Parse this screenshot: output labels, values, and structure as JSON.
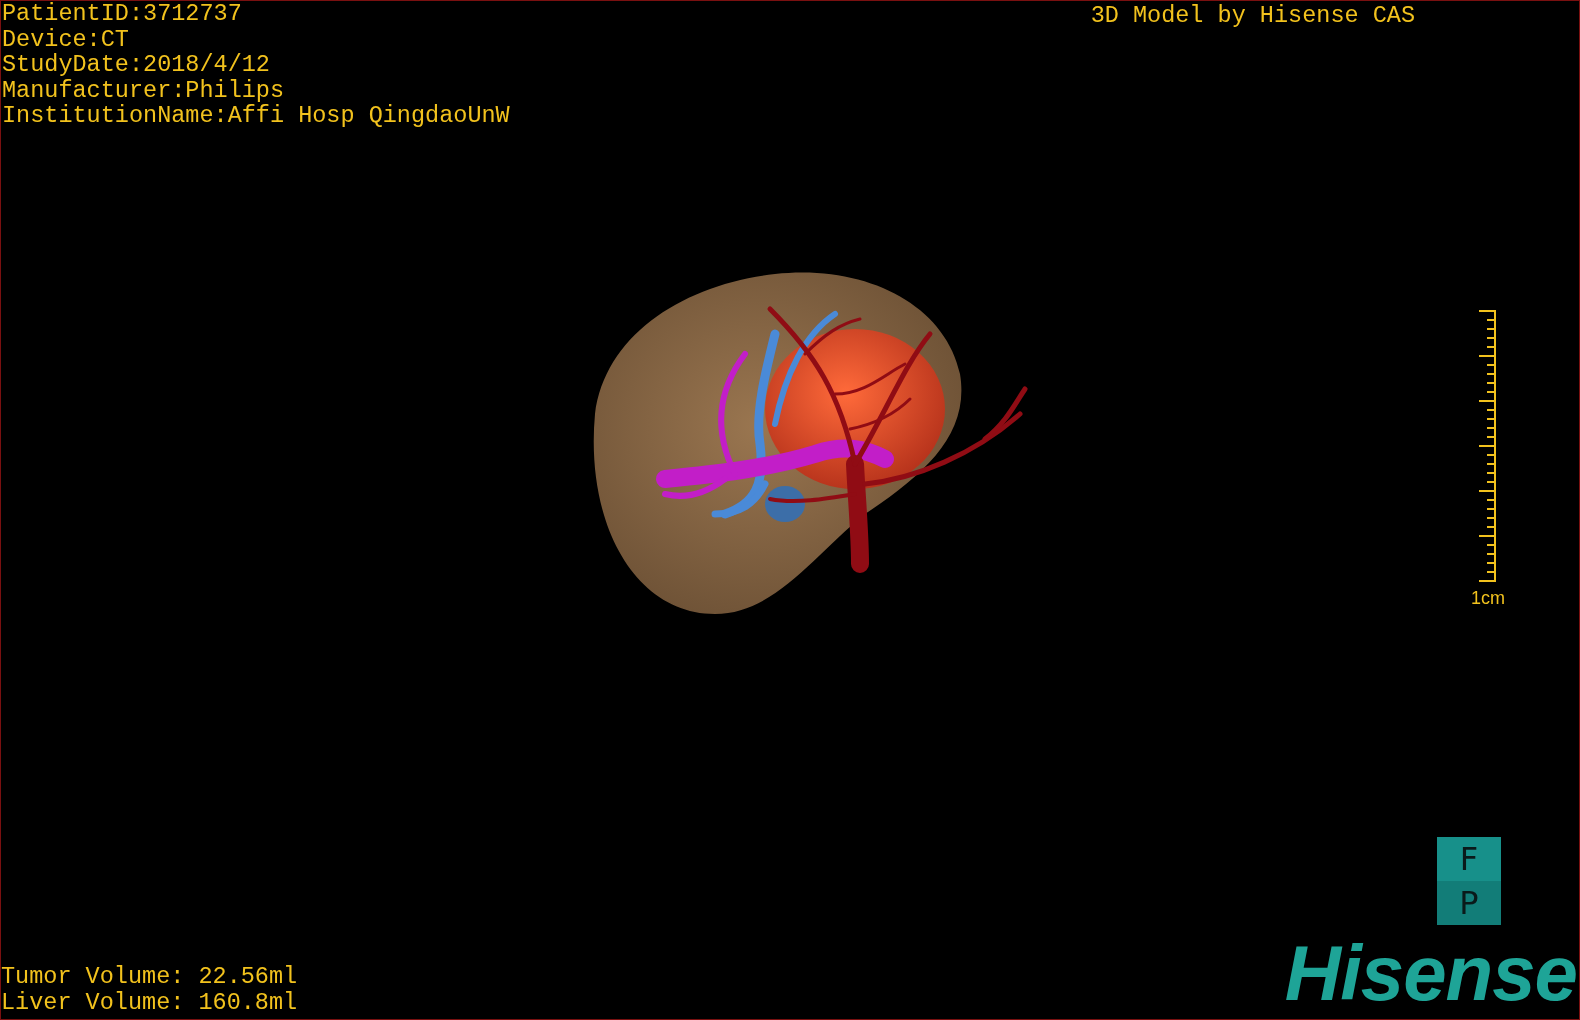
{
  "patient_info": [
    "PatientID:3712737",
    "Device:CT",
    "StudyDate:2018/4/12",
    "Manufacturer:Philips",
    "InstitutionName:Affi Hosp QingdaoUnW"
  ],
  "viewer_title": "3D Model by Hisense CAS",
  "scale_bar": {
    "label": "1cm"
  },
  "volumes": [
    "Tumor Volume: 22.56ml",
    "Liver Volume: 160.8ml"
  ],
  "orientation_cube": {
    "top": "F",
    "bottom": "P"
  },
  "logo": "Hisense"
}
